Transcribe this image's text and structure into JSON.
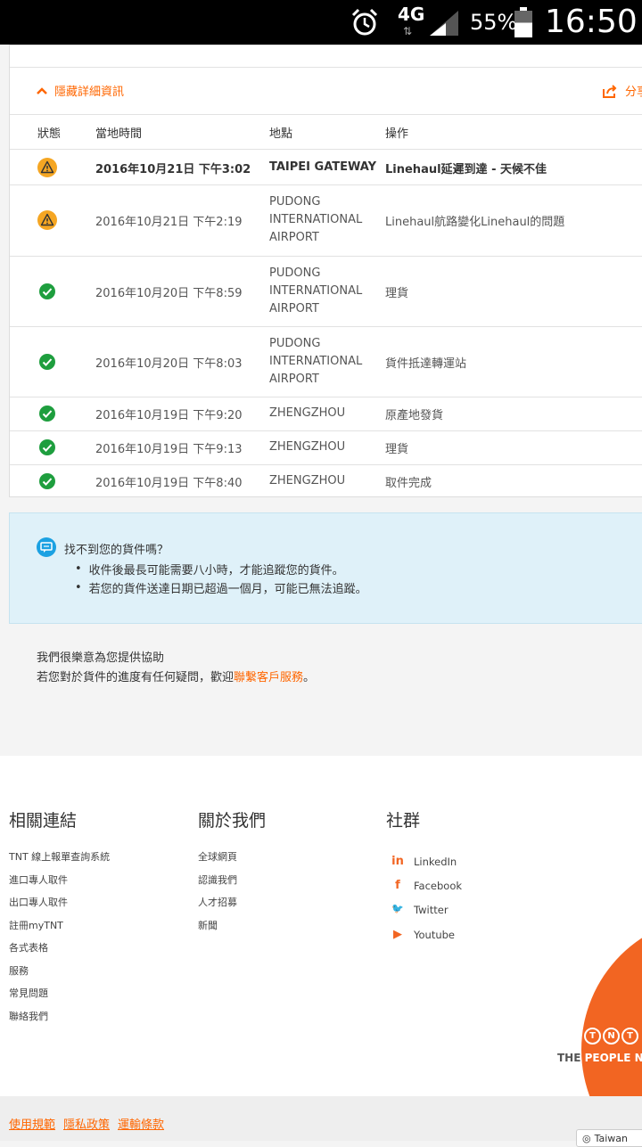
{
  "status_bar": {
    "network": "4G",
    "battery_percent": "55%",
    "battery_level": 0.55,
    "time": "16:50",
    "icons": [
      "alarm-icon",
      "signal-icon",
      "battery-icon"
    ]
  },
  "tracking": {
    "toggle_label": "隱藏詳細資訊",
    "share_label": "分享",
    "columns": [
      "狀態",
      "當地時間",
      "地點",
      "操作"
    ],
    "rows": [
      {
        "status": "warning",
        "time": "2016年10月21日 下午3:02",
        "location": "TAIPEI GATEWAY",
        "action": "Linehaul延遲到達 - 天候不佳",
        "bold": true
      },
      {
        "status": "warning",
        "time": "2016年10月21日 下午2:19",
        "location": "PUDONG INTERNATIONAL AIRPORT",
        "action": "Linehaul航路變化Linehaul的問題"
      },
      {
        "status": "ok",
        "time": "2016年10月20日 下午8:59",
        "location": "PUDONG INTERNATIONAL AIRPORT",
        "action": "理貨"
      },
      {
        "status": "ok",
        "time": "2016年10月20日 下午8:03",
        "location": "PUDONG INTERNATIONAL AIRPORT",
        "action": "貨件抵達轉運站"
      },
      {
        "status": "ok",
        "time": "2016年10月19日 下午9:20",
        "location": "ZHENGZHOU",
        "action": "原產地發貨"
      },
      {
        "status": "ok",
        "time": "2016年10月19日 下午9:13",
        "location": "ZHENGZHOU",
        "action": "理貨"
      },
      {
        "status": "ok",
        "time": "2016年10月19日 下午8:40",
        "location": "ZHENGZHOU",
        "action": "取件完成"
      }
    ]
  },
  "info_box": {
    "title": "找不到您的貨件嗎？",
    "items": [
      "收件後最長可能需要八小時，才能追蹤您的貨件。",
      "若您的貨件送達日期已超過一個月，可能已無法追蹤。"
    ]
  },
  "help": {
    "line1": "我們很樂意為您提供協助",
    "line2_prefix": "若您對於貨件的進度有任何疑問，歡迎",
    "link": "聯繫客戶服務",
    "line2_suffix": "。"
  },
  "footer": {
    "related": {
      "title": "相關連結",
      "links": [
        "TNT 線上報單查詢系統",
        "進口專人取件",
        "出口專人取件",
        "註冊myTNT",
        "各式表格",
        "服務",
        "常見問題",
        "聯絡我們"
      ]
    },
    "about": {
      "title": "關於我們",
      "links": [
        "全球網頁",
        "認識我們",
        "人才招募",
        "新聞"
      ]
    },
    "social": {
      "title": "社群",
      "links": [
        {
          "label": "LinkedIn",
          "icon": "linkedin-icon"
        },
        {
          "label": "Facebook",
          "icon": "facebook-icon"
        },
        {
          "label": "Twitter",
          "icon": "twitter-icon"
        },
        {
          "label": "Youtube",
          "icon": "youtube-icon"
        }
      ]
    },
    "brand": {
      "logo_letters": [
        "T",
        "N",
        "T"
      ],
      "tagline_a": "THE ",
      "tagline_b": "PEOPLE N",
      "color": "#f26522"
    }
  },
  "legal": {
    "links": [
      "使用規範",
      "隱私政策",
      "運輸條款"
    ],
    "region": "Taiwan"
  },
  "colors": {
    "accent": "#ff6600",
    "warning": "#f5a623",
    "success": "#1e9e3e",
    "info_bg": "#dff1f9"
  }
}
